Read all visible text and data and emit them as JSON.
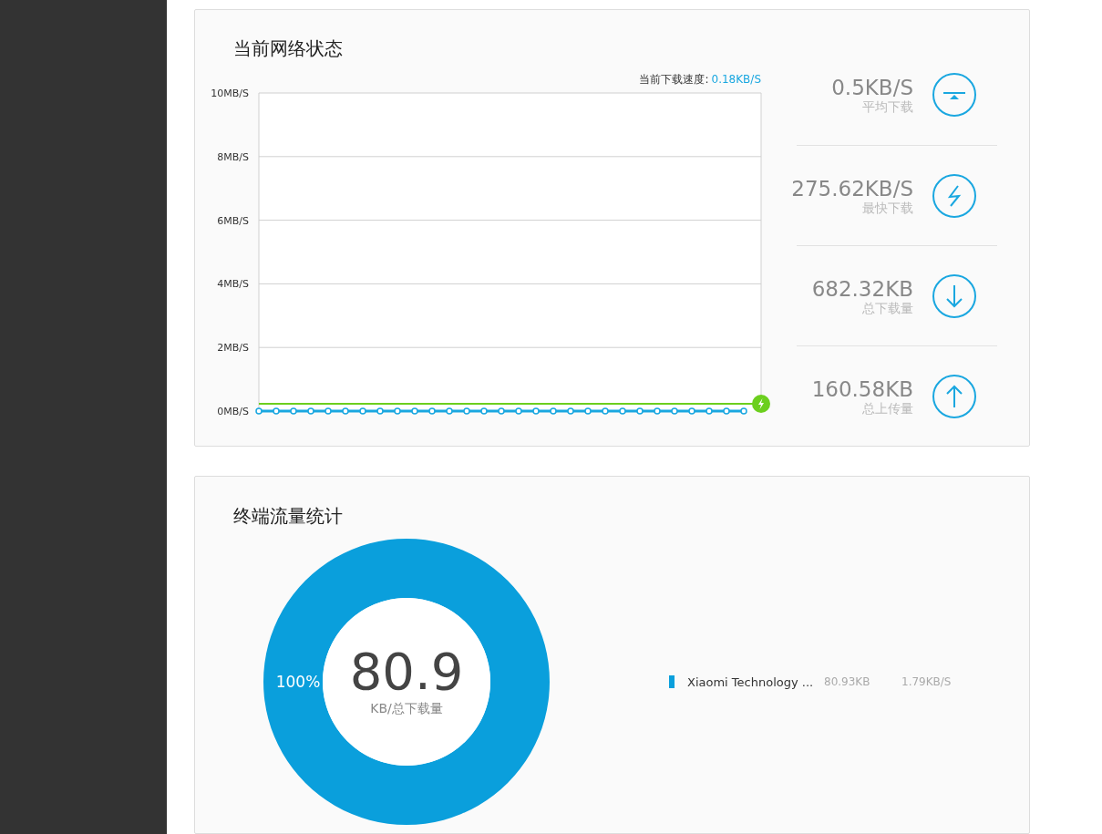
{
  "network_status": {
    "title": "当前网络状态",
    "current_speed": {
      "label": "当前下载速度:",
      "value": "0.18KB/S"
    },
    "chart_data": {
      "type": "line",
      "grid": true,
      "ylim": [
        0,
        10
      ],
      "yticks": [
        {
          "value": 0,
          "label": "0MB/S"
        },
        {
          "value": 2,
          "label": "2MB/S"
        },
        {
          "value": 4,
          "label": "4MB/S"
        },
        {
          "value": 6,
          "label": "6MB/S"
        },
        {
          "value": 8,
          "label": "8MB/S"
        },
        {
          "value": 10,
          "label": "10MB/S"
        }
      ],
      "series": [
        {
          "color": "#1aa7e0",
          "marker": "circle",
          "values": [
            0,
            0,
            0,
            0,
            0,
            0,
            0,
            0,
            0,
            0,
            0,
            0,
            0,
            0,
            0,
            0,
            0,
            0,
            0,
            0,
            0,
            0,
            0,
            0,
            0,
            0,
            0,
            0,
            0,
            null
          ]
        },
        {
          "color": "#6ccf1e",
          "values": [
            0.23,
            0.23,
            0.23,
            0.23,
            0.23,
            0.23,
            0.23,
            0.23,
            0.23,
            0.23,
            0.23,
            0.23,
            0.23,
            0.23,
            0.23,
            0.23,
            0.23,
            0.23,
            0.23,
            0.23,
            0.23,
            0.23,
            0.23,
            0.23,
            0.23,
            0.23,
            0.23,
            0.23,
            0.23,
            0.23
          ]
        }
      ]
    },
    "stats": [
      {
        "kind": "average",
        "value": "0.5KB/S",
        "label": "平均下载"
      },
      {
        "kind": "peak",
        "value": "275.62KB/S",
        "label": "最快下载"
      },
      {
        "kind": "download",
        "value": "682.32KB",
        "label": "总下载量"
      },
      {
        "kind": "upload",
        "value": "160.58KB",
        "label": "总上传量"
      }
    ]
  },
  "device_traffic": {
    "title": "终端流量统计",
    "center_value": "80.9",
    "center_label": "KB/总下载量",
    "chart_data": {
      "type": "donut",
      "categories": [
        "Xiaomi Technology ..."
      ],
      "values": [
        100
      ],
      "value_labels": [
        "100%"
      ]
    },
    "legend": [
      {
        "total": "80.93KB",
        "speed": "1.79KB/S",
        "color": "#0a9fdc"
      }
    ]
  }
}
